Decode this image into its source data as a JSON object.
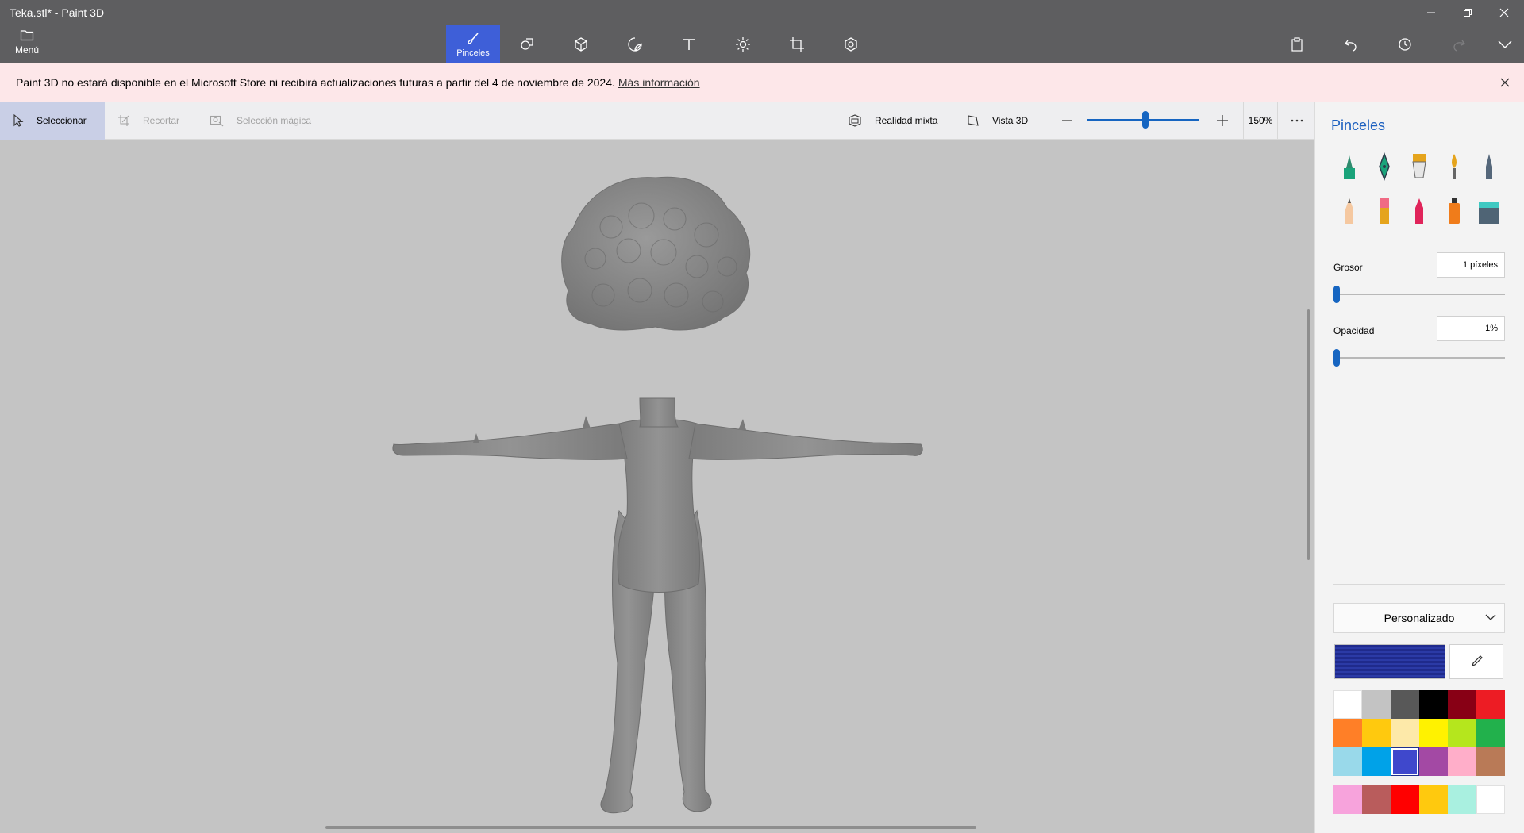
{
  "window": {
    "title": "Teka.stl* - Paint 3D"
  },
  "menu": {
    "label": "Menú"
  },
  "tools": {
    "active_label": "Pinceles"
  },
  "banner": {
    "message": "Paint 3D no estará disponible en el Microsoft Store ni recibirá actualizaciones futuras a partir del 4 de noviembre de 2024.",
    "link": "Más información"
  },
  "toolbar2": {
    "select": "Seleccionar",
    "crop": "Recortar",
    "magic_select": "Selección mágica",
    "mixed_reality": "Realidad mixta",
    "view_3d": "Vista 3D",
    "zoom_value": "150%",
    "zoom_level": 0.52
  },
  "panel": {
    "title": "Pinceles",
    "brushes": [
      "marker-icon",
      "calligraphy-pen-icon",
      "oil-brush-icon",
      "watercolor-icon",
      "pixel-pen-icon",
      "pencil-icon",
      "eraser-icon",
      "crayon-icon",
      "spray-can-icon",
      "fill-icon"
    ],
    "thickness_label": "Grosor",
    "thickness_value": "1 píxeles",
    "thickness_level": 0.0,
    "opacity_label": "Opacidad",
    "opacity_value": "1%",
    "opacity_level": 0.0,
    "palette_mode": "Personalizado",
    "current_color": "#1f2a8c",
    "selected_swatch": 14,
    "swatches": [
      "#ffffff",
      "#c3c3c3",
      "#585858",
      "#000000",
      "#880015",
      "#ed1c24",
      "#ff7f27",
      "#ffc90e",
      "#fde9a9",
      "#fff200",
      "#b5e61d",
      "#22b14c",
      "#99d9ea",
      "#00a2e8",
      "#3f48cc",
      "#a349a4",
      "#ffaec9",
      "#b97a57",
      "#f7a3dc",
      "#b95c5c",
      "#ff0000",
      "#ffc90e",
      "#a9f0e0",
      "#ffffff"
    ]
  },
  "colors": {
    "accent": "#3e5fd8",
    "titlebar": "#5e5e60",
    "banner_bg": "#fde7e9",
    "model": "#8a8a8a"
  }
}
